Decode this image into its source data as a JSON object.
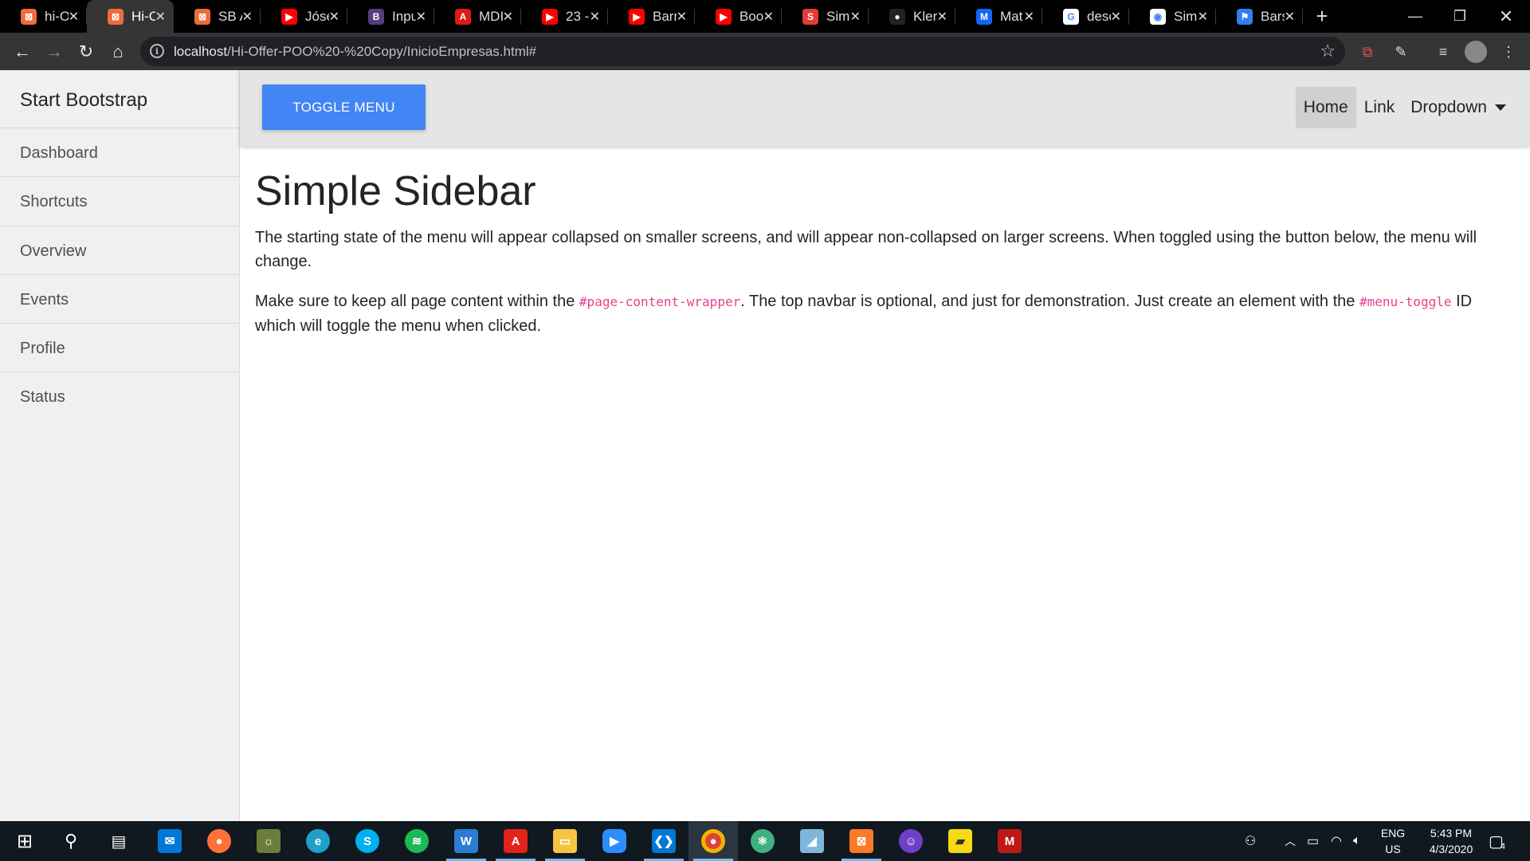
{
  "browser": {
    "tabs": [
      {
        "label": "hi-O",
        "fav_color": "#ee6c3a",
        "fav_glyph": "⊠",
        "active": false
      },
      {
        "label": "Hi-O",
        "fav_color": "#ee6c3a",
        "fav_glyph": "⊠",
        "active": true
      },
      {
        "label": "SB A",
        "fav_color": "#ee6c3a",
        "fav_glyph": "⊠",
        "active": false
      },
      {
        "label": "Jóse",
        "fav_color": "#ff0000",
        "fav_glyph": "▶",
        "active": false
      },
      {
        "label": "Inpu",
        "fav_color": "#563d7c",
        "fav_glyph": "B",
        "active": false
      },
      {
        "label": "MDI",
        "fav_color": "#dd1b16",
        "fav_glyph": "A",
        "active": false
      },
      {
        "label": "23 -",
        "fav_color": "#ff0000",
        "fav_glyph": "▶",
        "active": false
      },
      {
        "label": "Barr",
        "fav_color": "#ff0000",
        "fav_glyph": "▶",
        "active": false
      },
      {
        "label": "Boo",
        "fav_color": "#ff0000",
        "fav_glyph": "▶",
        "active": false
      },
      {
        "label": "Sim",
        "fav_color": "#e53935",
        "fav_glyph": "S",
        "active": false
      },
      {
        "label": "Kleri",
        "fav_color": "#222222",
        "fav_glyph": "●",
        "active": false
      },
      {
        "label": "Mat",
        "fav_color": "#1266f1",
        "fav_glyph": "M",
        "active": false
      },
      {
        "label": "desc",
        "fav_color": "#ffffff",
        "fav_glyph": "G",
        "active": false
      },
      {
        "label": "Sim",
        "fav_color": "#ffffff",
        "fav_glyph": "◉",
        "active": false
      },
      {
        "label": "Bars",
        "fav_color": "#2f80ed",
        "fav_glyph": "⚑",
        "active": false
      }
    ],
    "url_host": "localhost",
    "url_path": "/Hi-Offer-POO%20-%20Copy/InicioEmpresas.html#"
  },
  "sidebar": {
    "heading": "Start Bootstrap",
    "items": [
      {
        "label": "Dashboard"
      },
      {
        "label": "Shortcuts"
      },
      {
        "label": "Overview"
      },
      {
        "label": "Events"
      },
      {
        "label": "Profile"
      },
      {
        "label": "Status"
      }
    ]
  },
  "topnav": {
    "toggle_label": "TOGGLE MENU",
    "links": {
      "home": "Home",
      "link": "Link",
      "dropdown": "Dropdown"
    }
  },
  "main": {
    "title": "Simple Sidebar",
    "p1": "The starting state of the menu will appear collapsed on smaller screens, and will appear non-collapsed on larger screens. When toggled using the button below, the menu will change.",
    "p2_a": "Make sure to keep all page content within the ",
    "p2_code1": "#page-content-wrapper",
    "p2_b": ". The top navbar is optional, and just for demonstration. Just create an element with the ",
    "p2_code2": "#menu-toggle",
    "p2_c": " ID which will toggle the menu when clicked."
  },
  "taskbar": {
    "lang": "ENG",
    "region": "US",
    "time": "5:43 PM",
    "date": "4/3/2020",
    "notification_count": "4"
  },
  "colors": {
    "accent": "#4285f4",
    "code": "#e83e8c"
  }
}
